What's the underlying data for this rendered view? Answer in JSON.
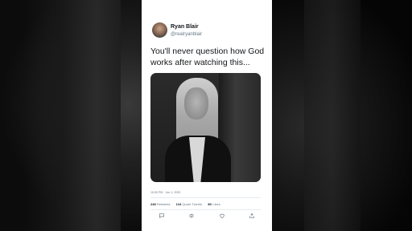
{
  "tweet": {
    "author_name": "Ryan Blair",
    "author_handle": "@realryanblair",
    "text": "You'll never question how God works after watching this...",
    "timestamp": "10:00 PM · Jun 1, 2020",
    "stats": {
      "retweets_count": "248",
      "retweets_label": "Retweets",
      "quote_count": "124",
      "quote_label": "Quote Tweets",
      "likes_count": "3K",
      "likes_label": "Likes"
    }
  },
  "icons": {
    "reply": "comment-icon",
    "retweet": "retweet-icon",
    "like": "heart-icon",
    "share": "share-icon"
  },
  "colors": {
    "card_background": "#ffffff",
    "primary_text": "#14171a",
    "secondary_text": "#657786",
    "page_background": "#000000"
  }
}
